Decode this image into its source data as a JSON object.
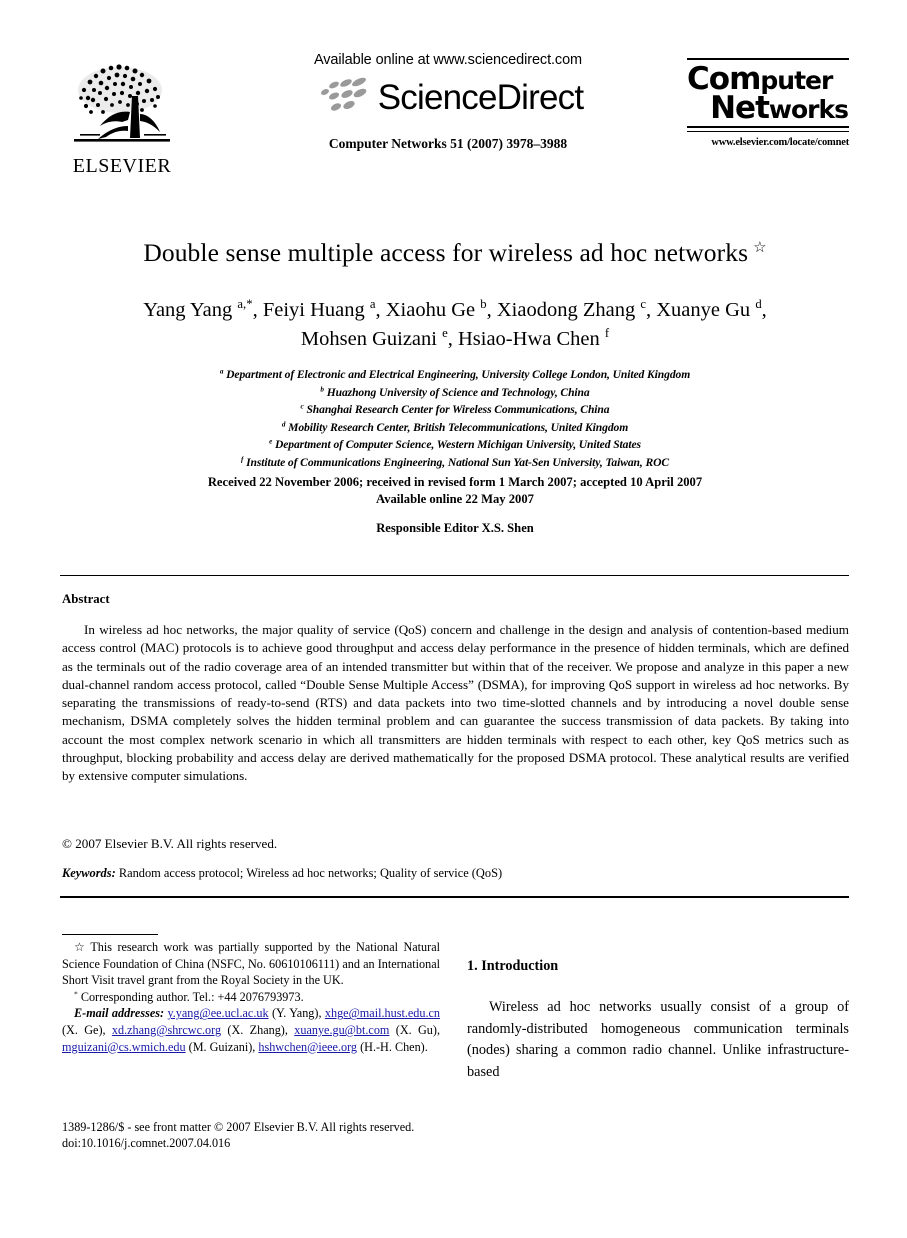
{
  "masthead": {
    "publisher_name": "ELSEVIER",
    "publisher_logo_icon": "elsevier-tree-icon",
    "available_online": "Available online at www.sciencedirect.com",
    "sciencedirect_wordmark": "ScienceDirect",
    "sciencedirect_logo_icon": "sciencedirect-leaves-icon",
    "journal_reference": "Computer Networks 51 (2007) 3978–3988",
    "cover": {
      "line1_a": "Co",
      "line1_b": "m",
      "line1_c": "puter",
      "line2_a": "Net",
      "line2_b": "works",
      "url": "www.elsevier.com/locate/comnet"
    }
  },
  "article": {
    "title": "Double sense multiple access for wireless ad hoc networks",
    "title_footnote_marker": "☆",
    "authors": [
      {
        "name": "Yang Yang",
        "marks": "a,*"
      },
      {
        "name": "Feiyi Huang",
        "marks": "a"
      },
      {
        "name": "Xiaohu Ge",
        "marks": "b"
      },
      {
        "name": "Xiaodong Zhang",
        "marks": "c"
      },
      {
        "name": "Xuanye Gu",
        "marks": "d"
      },
      {
        "name": "Mohsen Guizani",
        "marks": "e"
      },
      {
        "name": "Hsiao-Hwa Chen",
        "marks": "f"
      }
    ],
    "affiliations": [
      {
        "mark": "a",
        "text": "Department of Electronic and Electrical Engineering, University College London, United Kingdom"
      },
      {
        "mark": "b",
        "text": "Huazhong University of Science and Technology, China"
      },
      {
        "mark": "c",
        "text": "Shanghai Research Center for Wireless Communications, China"
      },
      {
        "mark": "d",
        "text": "Mobility Research Center, British Telecommunications, United Kingdom"
      },
      {
        "mark": "e",
        "text": "Department of Computer Science, Western Michigan University, United States"
      },
      {
        "mark": "f",
        "text": "Institute of Communications Engineering, National Sun Yat-Sen University, Taiwan, ROC"
      }
    ],
    "history_line1": "Received 22 November 2006; received in revised form 1 March 2007; accepted 10 April 2007",
    "history_line2": "Available online 22 May 2007",
    "responsible_editor": "Responsible Editor X.S. Shen"
  },
  "abstract": {
    "heading": "Abstract",
    "body": "In wireless ad hoc networks, the major quality of service (QoS) concern and challenge in the design and analysis of contention-based medium access control (MAC) protocols is to achieve good throughput and access delay performance in the presence of hidden terminals, which are defined as the terminals out of the radio coverage area of an intended transmitter but within that of the receiver. We propose and analyze in this paper a new dual-channel random access protocol, called “Double Sense Multiple Access” (DSMA), for improving QoS support in wireless ad hoc networks. By separating the transmissions of ready-to-send (RTS) and data packets into two time-slotted channels and by introducing a novel double sense mechanism, DSMA completely solves the hidden terminal problem and can guarantee the success transmission of data packets. By taking into account the most complex network scenario in which all transmitters are hidden terminals with respect to each other, key QoS metrics such as throughput, blocking probability and access delay are derived mathematically for the proposed DSMA protocol. These analytical results are verified by extensive computer simulations.",
    "copyright": "© 2007 Elsevier B.V. All rights reserved.",
    "keywords_label": "Keywords:",
    "keywords_value": "Random access protocol; Wireless ad hoc networks; Quality of service (QoS)"
  },
  "footnotes": {
    "funding_marker": "☆",
    "funding_text": "This research work was partially supported by the National Natural Science Foundation of China (NSFC, No. 60610106111) and an International Short Visit travel grant from the Royal Society in the UK.",
    "corresponding_marker": "*",
    "corresponding_text": "Corresponding author. Tel.: +44 2076793973.",
    "email_label": "E-mail addresses:",
    "emails": [
      {
        "address": "y.yang@ee.ucl.ac.uk",
        "person": "(Y. Yang)"
      },
      {
        "address": "xhge@mail.hust.edu.cn",
        "person": "(X. Ge)"
      },
      {
        "address": "xd.zhang@shrcwc.org",
        "person": "(X. Zhang)"
      },
      {
        "address": "xuanye.gu@bt.com",
        "person": "(X. Gu)"
      },
      {
        "address": "mguizani@cs.wmich.edu",
        "person": "(M. Guizani)"
      },
      {
        "address": "hshwchen@ieee.org",
        "person": "(H.-H. Chen)"
      }
    ],
    "link_color": "#1818a8"
  },
  "footer": {
    "issn_line": "1389-1286/$ - see front matter © 2007 Elsevier B.V. All rights reserved.",
    "doi_line": "doi:10.1016/j.comnet.2007.04.016"
  },
  "introduction": {
    "heading": "1. Introduction",
    "paragraph": "Wireless ad hoc networks usually consist of a group of randomly-distributed homogeneous communication terminals (nodes) sharing a common radio channel. Unlike infrastructure-based"
  }
}
